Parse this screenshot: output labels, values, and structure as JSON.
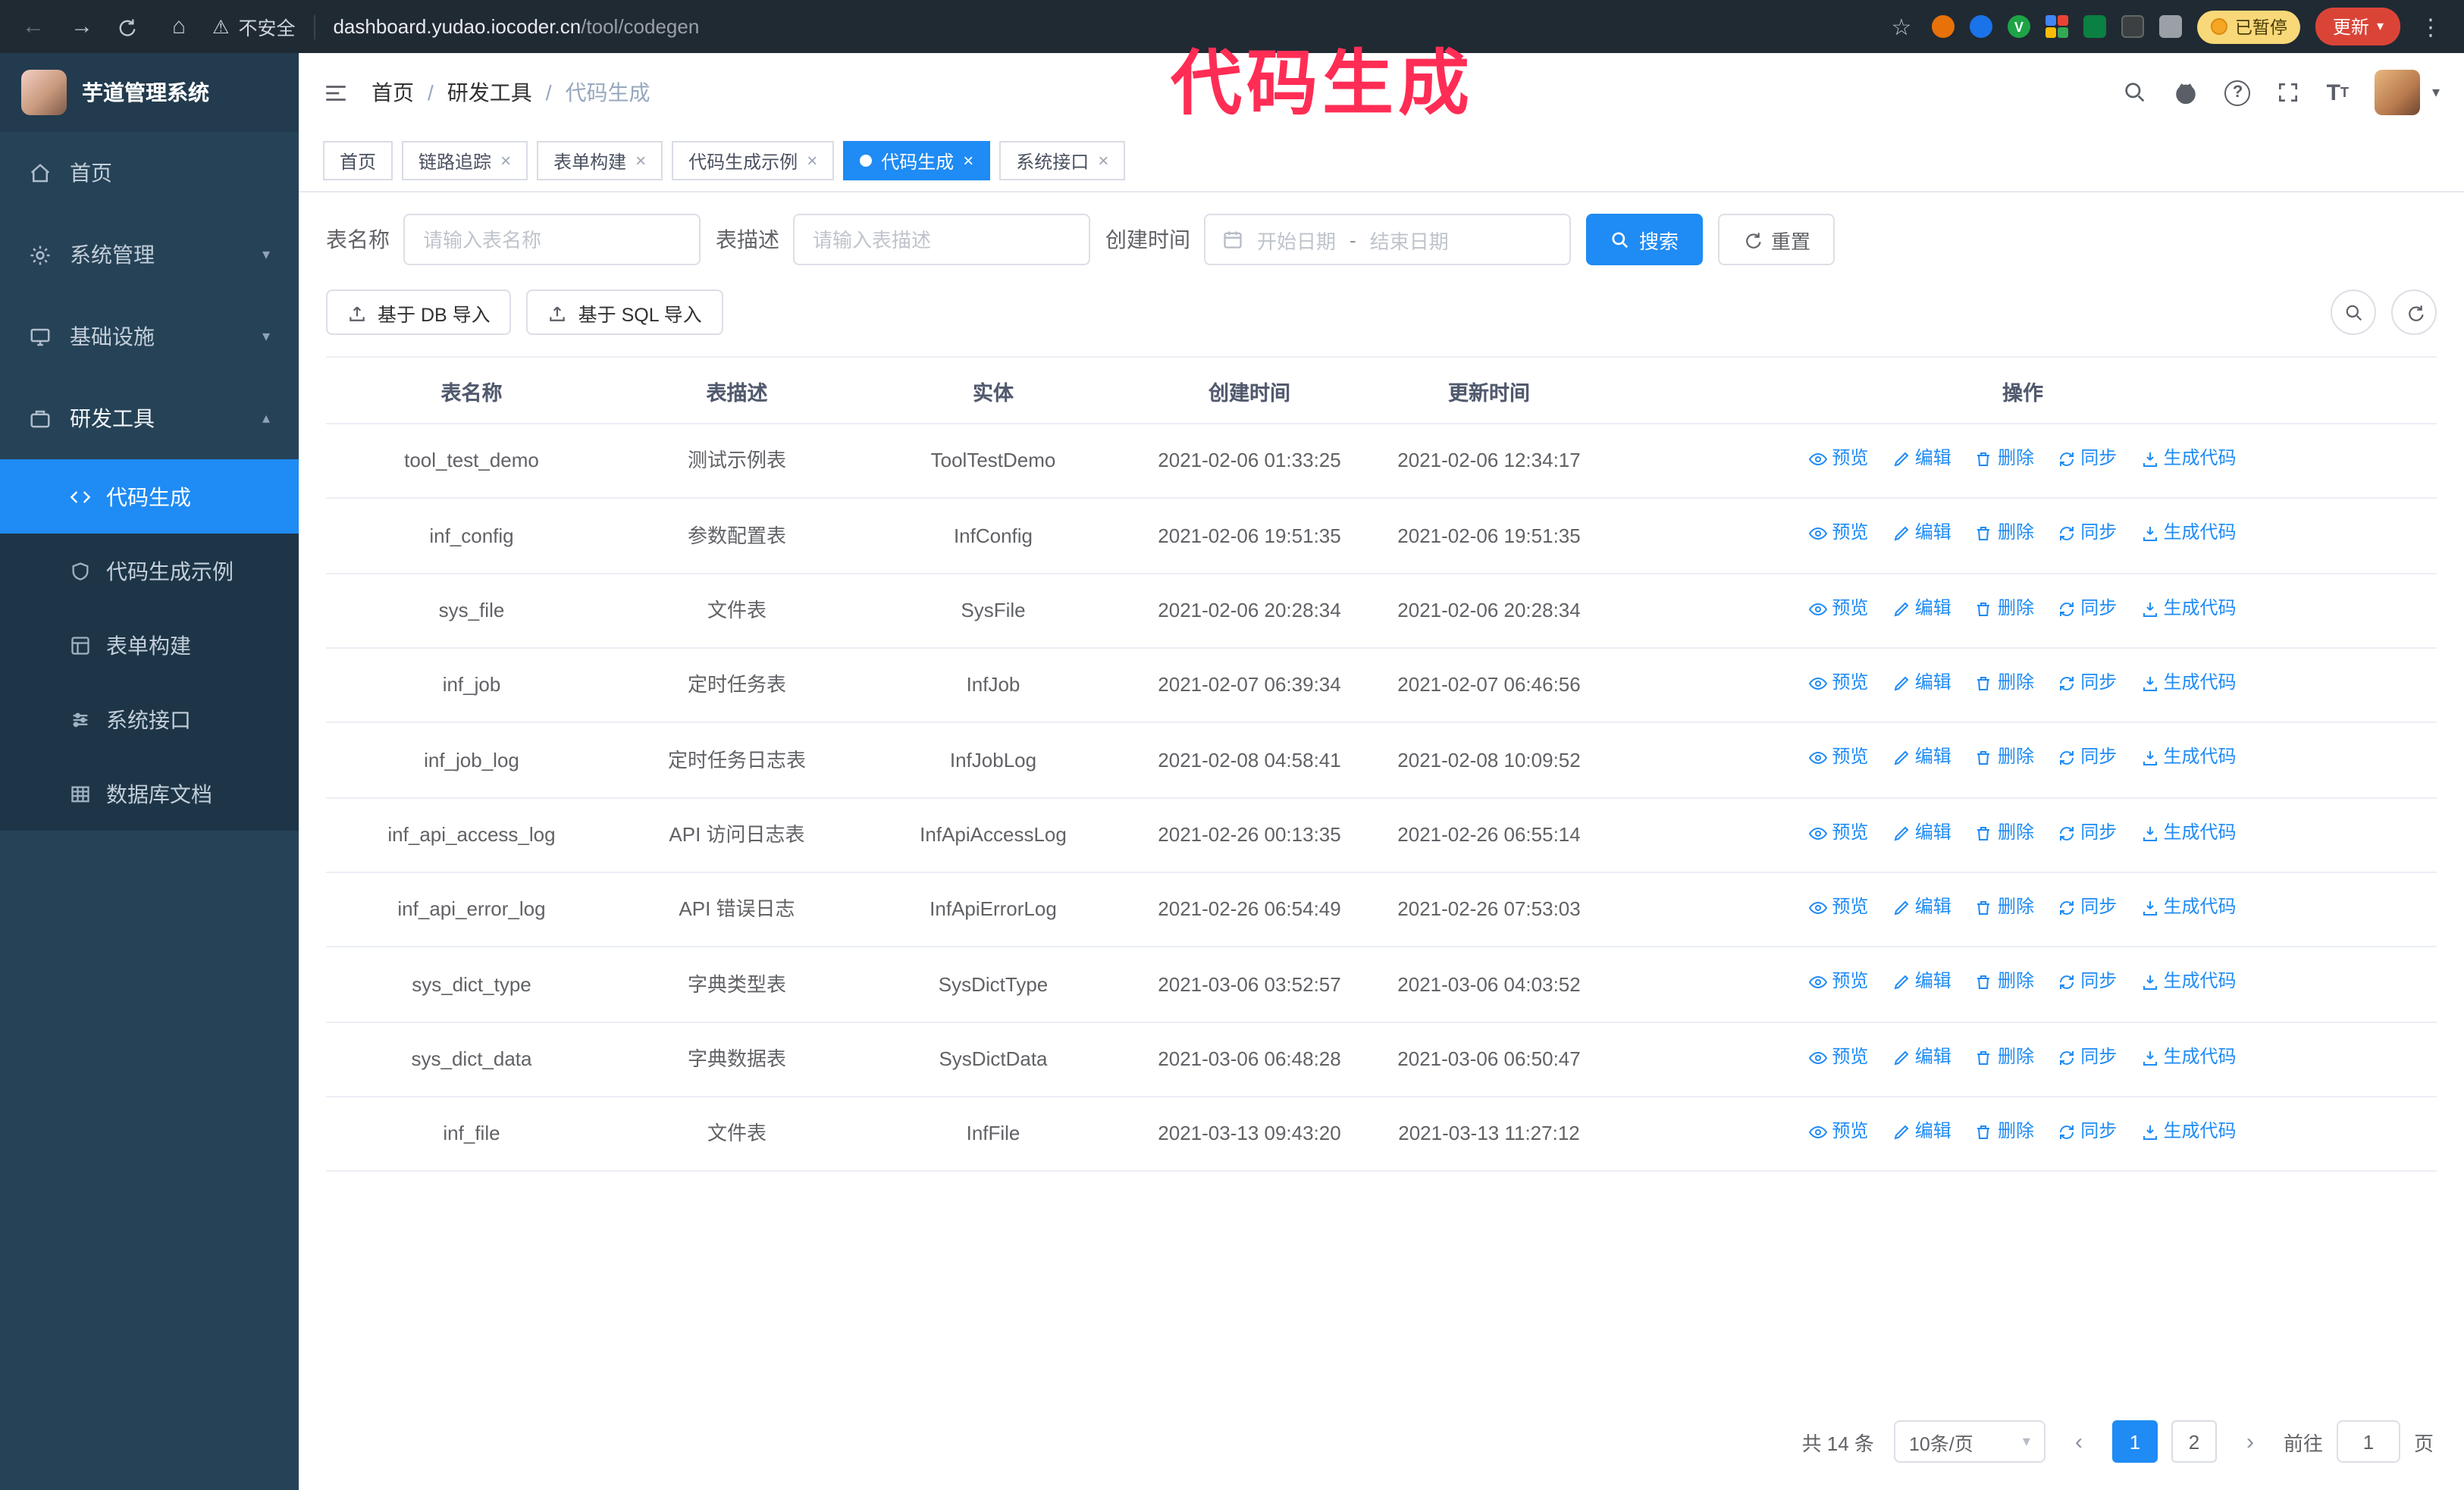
{
  "browser": {
    "insecure_label": "不安全",
    "url_domain": "dashboard.yudao.iocoder.cn",
    "url_path": "/tool/codegen",
    "paused_badge": "已暂停",
    "update_button": "更新"
  },
  "annotation": {
    "text": "代码生成",
    "color": "#ff2d55"
  },
  "sidebar": {
    "title": "芋道管理系统",
    "items": [
      {
        "label": "首页"
      },
      {
        "label": "系统管理"
      },
      {
        "label": "基础设施"
      },
      {
        "label": "研发工具"
      }
    ],
    "submenu": [
      {
        "label": "代码生成"
      },
      {
        "label": "代码生成示例"
      },
      {
        "label": "表单构建"
      },
      {
        "label": "系统接口"
      },
      {
        "label": "数据库文档"
      }
    ]
  },
  "header": {
    "breadcrumb": [
      "首页",
      "研发工具",
      "代码生成"
    ]
  },
  "tabs": {
    "items": [
      {
        "label": "首页"
      },
      {
        "label": "链路追踪"
      },
      {
        "label": "表单构建"
      },
      {
        "label": "代码生成示例"
      },
      {
        "label": "代码生成"
      },
      {
        "label": "系统接口"
      }
    ]
  },
  "filters": {
    "table_name_label": "表名称",
    "table_name_placeholder": "请输入表名称",
    "table_desc_label": "表描述",
    "table_desc_placeholder": "请输入表描述",
    "create_time_label": "创建时间",
    "date_start_placeholder": "开始日期",
    "date_separator": "-",
    "date_end_placeholder": "结束日期",
    "search_button": "搜索",
    "reset_button": "重置"
  },
  "toolbar": {
    "db_import": "基于 DB 导入",
    "sql_import": "基于 SQL 导入"
  },
  "table": {
    "columns": [
      "表名称",
      "表描述",
      "实体",
      "创建时间",
      "更新时间",
      "操作"
    ],
    "actions": [
      "预览",
      "编辑",
      "删除",
      "同步",
      "生成代码"
    ],
    "rows": [
      {
        "name": "tool_test_demo",
        "desc": "测试示例表",
        "entity": "ToolTestDemo",
        "create_time": "2021-02-06 01:33:25",
        "update_time": "2021-02-06 12:34:17"
      },
      {
        "name": "inf_config",
        "desc": "参数配置表",
        "entity": "InfConfig",
        "create_time": "2021-02-06 19:51:35",
        "update_time": "2021-02-06 19:51:35"
      },
      {
        "name": "sys_file",
        "desc": "文件表",
        "entity": "SysFile",
        "create_time": "2021-02-06 20:28:34",
        "update_time": "2021-02-06 20:28:34"
      },
      {
        "name": "inf_job",
        "desc": "定时任务表",
        "entity": "InfJob",
        "create_time": "2021-02-07 06:39:34",
        "update_time": "2021-02-07 06:46:56"
      },
      {
        "name": "inf_job_log",
        "desc": "定时任务日志表",
        "entity": "InfJobLog",
        "create_time": "2021-02-08 04:58:41",
        "update_time": "2021-02-08 10:09:52"
      },
      {
        "name": "inf_api_access_log",
        "desc": "API 访问日志表",
        "entity": "InfApiAccessLog",
        "create_time": "2021-02-26 00:13:35",
        "update_time": "2021-02-26 06:55:14"
      },
      {
        "name": "inf_api_error_log",
        "desc": "API 错误日志",
        "entity": "InfApiErrorLog",
        "create_time": "2021-02-26 06:54:49",
        "update_time": "2021-02-26 07:53:03"
      },
      {
        "name": "sys_dict_type",
        "desc": "字典类型表",
        "entity": "SysDictType",
        "create_time": "2021-03-06 03:52:57",
        "update_time": "2021-03-06 04:03:52"
      },
      {
        "name": "sys_dict_data",
        "desc": "字典数据表",
        "entity": "SysDictData",
        "create_time": "2021-03-06 06:48:28",
        "update_time": "2021-03-06 06:50:47"
      },
      {
        "name": "inf_file",
        "desc": "文件表",
        "entity": "InfFile",
        "create_time": "2021-03-13 09:43:20",
        "update_time": "2021-03-13 11:27:12"
      }
    ]
  },
  "pagination": {
    "total": "共 14 条",
    "page_size": "10条/页",
    "pages": [
      "1",
      "2"
    ],
    "goto_label": "前往",
    "goto_value": "1",
    "unit": "页"
  }
}
